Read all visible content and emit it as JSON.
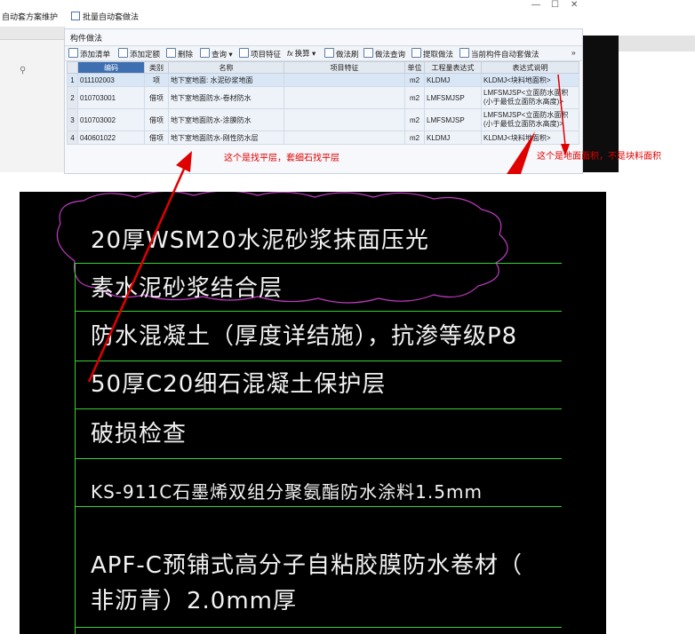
{
  "topbar": {
    "item1": "自动套方案维护",
    "item2": "批量自动套做法",
    "win_min": "—",
    "win_max": "☐",
    "win_close": "✕"
  },
  "panel": {
    "title": "构件做法",
    "toolbar": [
      "添加清单",
      "添加定额",
      "删除",
      "查询",
      "项目特征",
      "换算",
      "做法刷",
      "做法查询",
      "提取做法",
      "当前构件自动套做法"
    ]
  },
  "grid": {
    "columns": [
      "编码",
      "类别",
      "名称",
      "项目特征",
      "单位",
      "工程量表达式",
      "表达式说明"
    ],
    "rows": [
      {
        "num": "1",
        "code": "011102003",
        "type": "项",
        "name": "地下室地面: 水泥砂浆地面",
        "feature": "",
        "unit": "m2",
        "expr": "KLDMJ",
        "desc": "KLDMJ<块料地面积>"
      },
      {
        "num": "2",
        "code": "010703001",
        "type": "借项",
        "name": "地下室地面防水-卷材防水",
        "feature": "",
        "unit": "m2",
        "expr": "LMFSMJSP",
        "desc": "LMFSMJSP<立面防水面积(小于最低立面防水高度)>"
      },
      {
        "num": "3",
        "code": "010703002",
        "type": "借项",
        "name": "地下室地面防水-涂膜防水",
        "feature": "",
        "unit": "m2",
        "expr": "LMFSMJSP",
        "desc": "LMFSMJSP<立面防水面积(小于最低立面防水高度)>"
      },
      {
        "num": "4",
        "code": "040601022",
        "type": "借项",
        "name": "地下室地面防水-刚性防水层",
        "feature": "",
        "unit": "m2",
        "expr": "KLDMJ",
        "desc": "KLDMJ<块料地面积>"
      }
    ]
  },
  "annotations": {
    "left": "这个是找平层，套细石找平层",
    "right": "这个是地面面积，不是块料面积"
  },
  "cad": {
    "lines": [
      "20厚WSM20水泥砂浆抹面压光",
      "素水泥砂浆结合层",
      "防水混凝土（厚度详结施），抗渗等级P8",
      "50厚C20细石混凝土保护层",
      "破损检查",
      "KS-911C石墨烯双组分聚氨酯防水涂料1.5mm",
      "APF-C预铺式高分子自粘胶膜防水卷材（",
      "非沥青）2.0mm厚"
    ]
  },
  "colors": {
    "annotation": "#e00000",
    "cad_bg": "#000000",
    "cad_line": "#37d137",
    "cad_cloud": "#c23bc2",
    "selected_header": "#3e6fb1"
  }
}
